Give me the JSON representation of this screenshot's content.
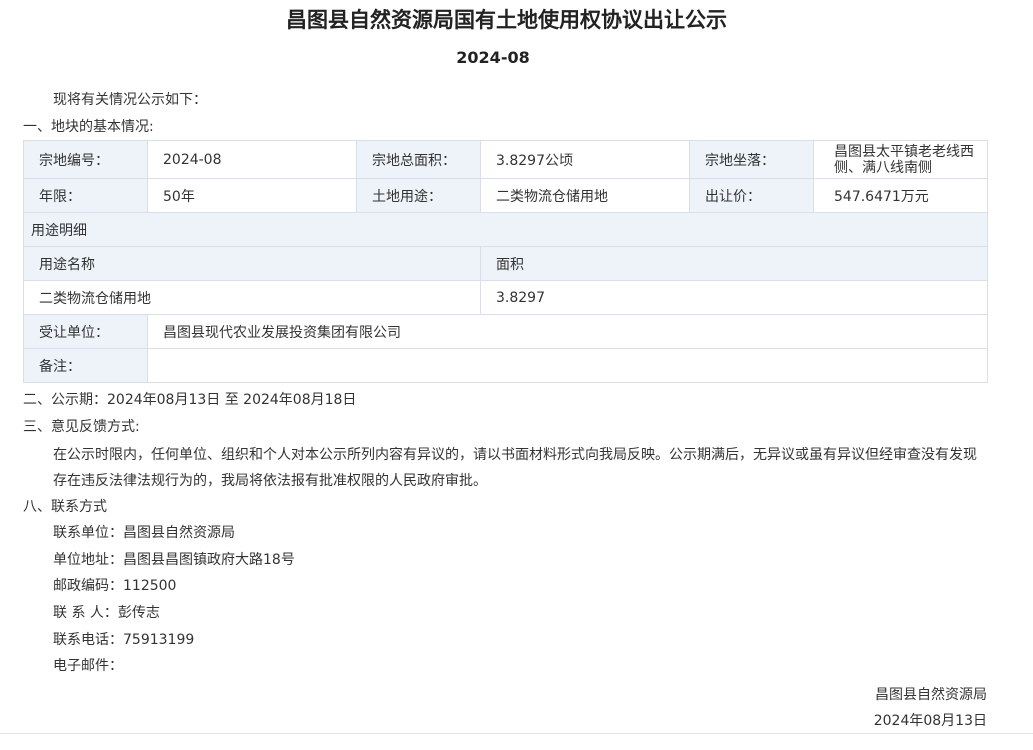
{
  "title": "昌图县自然资源局国有土地使用权协议出让公示",
  "subtitle": "2024-08",
  "intro": "现将有关情况公示如下：",
  "section1": "一、地块的基本情况:",
  "table": {
    "row1": {
      "l1": "宗地编号：",
      "v1": "2024-08",
      "l2": "宗地总面积：",
      "v2": "3.8297公顷",
      "l3": "宗地坐落：",
      "v3": "昌图县太平镇老老线西侧、满八线南侧"
    },
    "row2": {
      "l1": "年限：",
      "v1": "50年",
      "l2": "土地用途：",
      "v2": "二类物流仓储用地",
      "l3": "出让价：",
      "v3": "547.6471万元"
    },
    "usage_detail": "用途明细",
    "usage_header_name": "用途名称",
    "usage_header_area": "面积",
    "usage_rows": [
      {
        "name": "二类物流仓储用地",
        "area": "3.8297"
      }
    ],
    "grantee_label": "受让单位：",
    "grantee_value": "昌图县现代农业发展投资集团有限公司",
    "remark_label": "备注：",
    "remark_value": ""
  },
  "section2": "二、公示期：2024年08月13日 至 2024年08月18日",
  "section3": "三、意见反馈方式:",
  "feedback": "在公示时限内，任何单位、组织和个人对本公示所列内容有异议的，请以书面材料形式向我局反映。公示期满后，无异议或虽有异议但经审查没有发现存在违反法律法规行为的，我局将依法报有批准权限的人民政府审批。",
  "section8": "八、联系方式",
  "contact": {
    "unit": "联系单位：昌图县自然资源局",
    "address": "单位地址：昌图县昌图镇政府大路18号",
    "postcode": "邮政编码：112500",
    "person": "联 系 人：彭传志",
    "phone": "联系电话：75913199",
    "email": "电子邮件："
  },
  "signature": {
    "org": "昌图县自然资源局",
    "date": "2024年08月13日"
  }
}
